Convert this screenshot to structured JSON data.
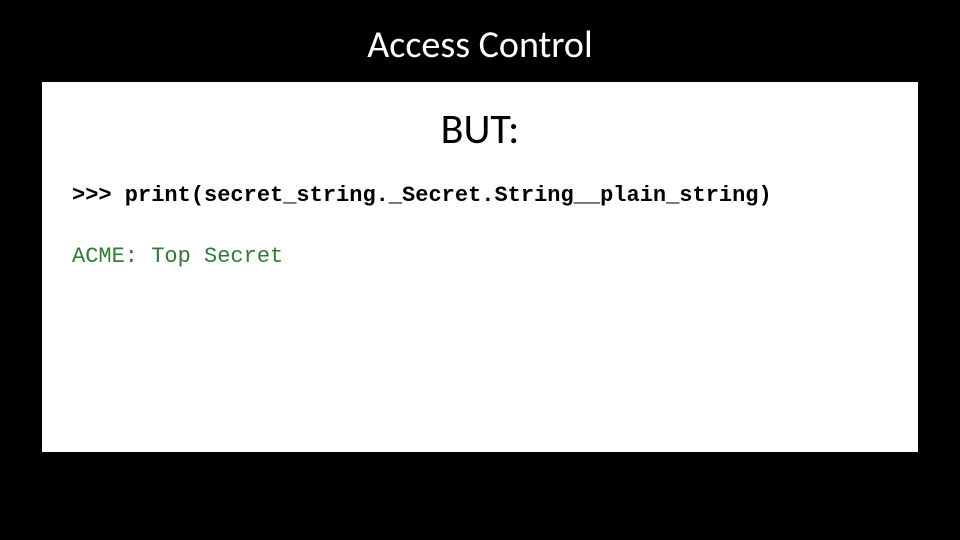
{
  "slide": {
    "title": "Access Control",
    "subtitle": "BUT:",
    "code": ">>> print(secret_string._Secret.String__plain_string)",
    "output": "ACME: Top Secret"
  }
}
